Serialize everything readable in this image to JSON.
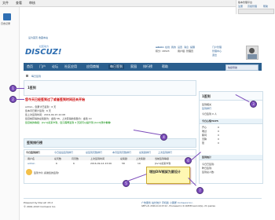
{
  "browser": {
    "tabs": [
      "文件",
      "查看",
      "审核"
    ],
    "sidebar_item": "日志记录"
  },
  "topright": {
    "title": "版本管理平台",
    "links": [
      "注册",
      "高级管理",
      "帮助"
    ]
  },
  "header": {
    "top_left": "设为首页 收藏本站",
    "logo_line1": "社区动力",
    "logo_line2": "DISCUZ!",
    "user": "admin",
    "user_links": [
      "在线",
      "我的",
      "设置",
      "消息",
      "提醒",
      "门户管理",
      "管理中心",
      "退出"
    ],
    "points": "积分: 18323",
    "group": "用户组: 管理员"
  },
  "nav": {
    "items": [
      "首页",
      "门户",
      "论坛",
      "社区应用",
      "应用商城",
      "每日签到",
      "家园",
      "排行榜",
      "帮助"
    ],
    "active": "每日签到",
    "search_placeholder": "快捷导航"
  },
  "breadcrumb": "每日签到",
  "main": {
    "heading": "1签到",
    "title": "您今天已经签到过了或者签到时间还未开始",
    "info_lines": [
      "admin，您累计已签到：6 天",
      "您本月已累计签到：6 天",
      "您上次签到时间：2016-09-15 22:08",
      "您目前获得的总奖励为：金钱 58，上次获得的奖励为：金钱 10",
      "您目前的等级：[LV.1]初来乍到，您只需再签到 4 天就可以提升到 [LV.2]偶尔看看I"
    ],
    "rank_heading": "签到排行榜",
    "tabs": [
      "今日签到排行",
      "今日最后签到排行",
      "总签到天数排行",
      "本月签到天数排行",
      "总奖励排行",
      "上次签到排行"
    ],
    "table_headers": [
      "用户名",
      "总天数",
      "月天数",
      "上次签到时间",
      "总奖励",
      "上次奖励",
      "当前签到等级"
    ],
    "rows": [
      [
        "admin",
        "6",
        "6",
        "2016-09-14 23:06",
        "58",
        "10",
        "[LV.1]初来乍到"
      ]
    ],
    "cartoon_line": "签到卡片 感谢您的签到!"
  },
  "sidebar": {
    "heading": "1签到",
    "stats_title": "签到相关",
    "stats_link": "签到排行",
    "stats_text": "今日签到 0 人",
    "mood_title": "今日心情TOP5",
    "moods": [
      "开心",
      "难过",
      "郁闷",
      "无聊",
      "怒"
    ],
    "mood_counts": [
      "0",
      "0",
      "0",
      "0",
      "0"
    ],
    "bottom_title": "签到统计",
    "bottom_lines": [
      "今日已签到:",
      "昨日签到:",
      "签到总人数:"
    ]
  },
  "tooltip_text": "增加DIV框架为要设计",
  "annotations": [
    "1",
    "2",
    "3",
    "4",
    "5",
    "6",
    "7"
  ],
  "footer": {
    "left": "Powered by Discuz! X3.2",
    "left2": "© 2001-2013 Comsenz Inc.",
    "right": "广告服务 站长统计 手机版 小黑屋 Comsenz Inc.",
    "right2": "GMT+8, 2016-9-14 23:12 , Processed in 0.104539 second(s), 21 queries"
  }
}
